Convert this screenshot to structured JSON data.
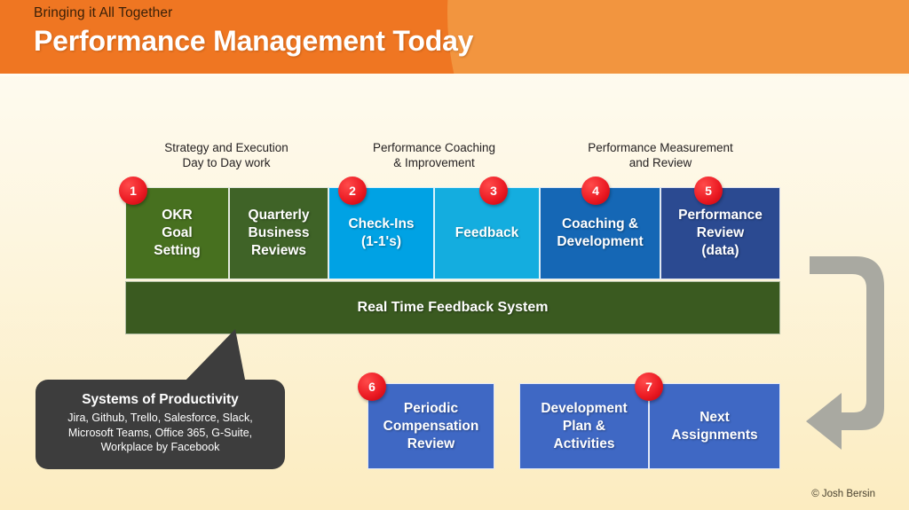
{
  "header": {
    "eyebrow": "Bringing it All Together",
    "title": "Performance Management Today",
    "background_color": "#ef7622",
    "accent_color": "#f2953f"
  },
  "captions": [
    {
      "text": "Strategy and Execution\nDay to Day work"
    },
    {
      "text": "Performance Coaching\n& Improvement"
    },
    {
      "text": "Performance Measurement\nand Review"
    }
  ],
  "stages": [
    {
      "number": "1",
      "label": "OKR\nGoal\nSetting",
      "color": "#47701f"
    },
    {
      "number": "",
      "label": "Quarterly\nBusiness\nReviews",
      "color": "#3f6327"
    },
    {
      "number": "2",
      "label": "Check-Ins\n(1-1's)",
      "color": "#00a2e4"
    },
    {
      "number": "3",
      "label": "Feedback",
      "color": "#14addf"
    },
    {
      "number": "4",
      "label": "Coaching &\nDevelopment",
      "color": "#1567b5"
    },
    {
      "number": "5",
      "label": "Performance\nReview\n(data)",
      "color": "#2b4a91"
    }
  ],
  "realtime_bar": {
    "label": "Real Time Feedback System",
    "color": "#3a5a20"
  },
  "callout": {
    "title": "Systems of Productivity",
    "body": "Jira, Github, Trello, Salesforce, Slack, Microsoft Teams, Office 365, G-Suite, Workplace by Facebook",
    "color": "#3d3d3d"
  },
  "bottom_stages": [
    {
      "number": "6",
      "label": "Periodic\nCompensation\nReview",
      "color": "#3f68c4"
    },
    {
      "number": "",
      "label": "Development\nPlan &\nActivities",
      "color": "#3f68c4"
    },
    {
      "number": "7",
      "label": "Next\nAssignments",
      "color": "#3f68c4"
    }
  ],
  "arrow": {
    "name": "loop-back-arrow",
    "color": "#a9a9a1"
  },
  "copyright": "© Josh Bersin"
}
